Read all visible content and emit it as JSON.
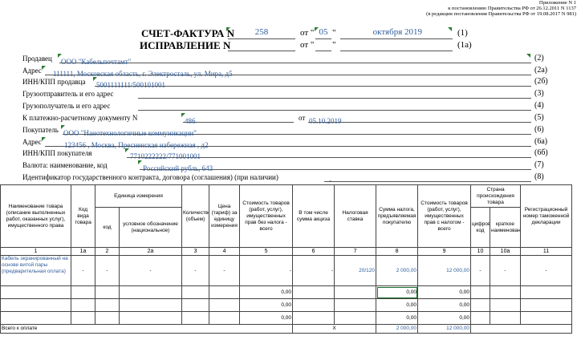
{
  "appendix": {
    "line1": "Приложение N 1",
    "line2": "к постановлению Правительства РФ от 26.12.2011 N 1137",
    "line3": "(в редакции постановления Правительства РФ от 19.08.2017 N 981)"
  },
  "header": {
    "invoice_title": "СЧЕТ-ФАКТУРА N",
    "invoice_number": "258",
    "date_prefix": "от \"",
    "day": "05",
    "quote_close": "\"",
    "month_year": "октября 2019",
    "code1": "(1)",
    "correction_title": "ИСПРАВЛЕНИЕ N",
    "correction_number": "",
    "correction_date_prefix": "от \"",
    "correction_day": "",
    "correction_quote_close": "\"",
    "correction_month": "",
    "code1a": "(1а)"
  },
  "fields": [
    {
      "label": "Продавец",
      "value": "ООО \"Кабельпочтамт\"",
      "code": "(2)"
    },
    {
      "label": "Адрес",
      "value": "111111, Московская область, г. Электросталь, ул. Мира, д5",
      "code": "(2а)"
    },
    {
      "label": "ИНН/КПП продавца",
      "value": "5001111111/500101001",
      "code": "(2б)"
    },
    {
      "label": "Грузоотправитель и его адрес",
      "value": "",
      "code": "(3)"
    },
    {
      "label": "Грузополучатель и его адрес",
      "value": "",
      "code": "(4)"
    },
    {
      "label": "К платежно-расчетному документу N",
      "value": "486",
      "mid": "от",
      "value2": "05.10.2019",
      "code": "(5)"
    },
    {
      "label": "Покупатель",
      "value": "ООО \"Нанотехнологичные коммуникации\"",
      "code": "(6)"
    },
    {
      "label": "Адрес",
      "value": "123456 , Москва, Пресненская набережная , д2",
      "code": "(6а)"
    },
    {
      "label": "ИНН/КПП покупателя",
      "value": "7710222222/771001001",
      "code": "(6б)"
    },
    {
      "label": "Валюта: наименование, код",
      "value": "Российский рубль, 643",
      "code": "(7)"
    },
    {
      "label": "Идентификатор государственного контракта, договора (соглашения) (при наличии)",
      "value": "-",
      "code": "(8)"
    }
  ],
  "table": {
    "headers": {
      "name": "Наименование товара (описание выполненных работ, оказанных услуг), имущественного права",
      "kind_code": "Код вида товара",
      "unit_group": "Единица измерения",
      "unit_code": "код",
      "unit_name": "условное обозначение (национальное)",
      "qty": "Количество (объем)",
      "price": "Цена (тариф) за единицу измерения",
      "cost_no_tax": "Стоимость товаров (работ, услуг), имущественных прав без налога - всего",
      "excise": "В том числе сумма акциза",
      "tax_rate": "Налоговая ставка",
      "tax_sum": "Сумма налога, предъявляемая покупателю",
      "cost_with_tax": "Стоимость товаров (работ, услуг), имущественных прав с налогом - всего",
      "country_group": "Страна происхождения товара",
      "country_code": "цифровой код",
      "country_name": "краткое наименование",
      "customs": "Регистрационный номер таможенной декларации"
    },
    "numbers": [
      "1",
      "1а",
      "2",
      "2а",
      "3",
      "4",
      "5",
      "6",
      "7",
      "8",
      "9",
      "10",
      "10а",
      "11"
    ],
    "item": {
      "name": "Кабель экранированный на основе витой пары (предварительная оплата)",
      "kind_code": "-",
      "unit_code": "-",
      "unit_name": "-",
      "qty": "-",
      "price": "-",
      "cost_no_tax": "-",
      "excise": "-",
      "tax_rate": "20/120",
      "tax_sum": "2 000,00",
      "cost_with_tax": "12 000,00",
      "country_code": "-",
      "country_name": "-",
      "customs": "-"
    },
    "empty_rows": [
      {
        "cost_no_tax": "0,00",
        "tax_sum": "0,00",
        "cost_with_tax": "0,00"
      },
      {
        "cost_no_tax": "0,00",
        "tax_sum": "0,00",
        "cost_with_tax": "0,00"
      },
      {
        "cost_no_tax": "0,00",
        "tax_sum": "0,00",
        "cost_with_tax": "0,00"
      }
    ],
    "total": {
      "label": "Всего к оплате",
      "excise": "X",
      "tax_sum": "2 000,00",
      "cost_with_tax": "12 000,00"
    }
  }
}
